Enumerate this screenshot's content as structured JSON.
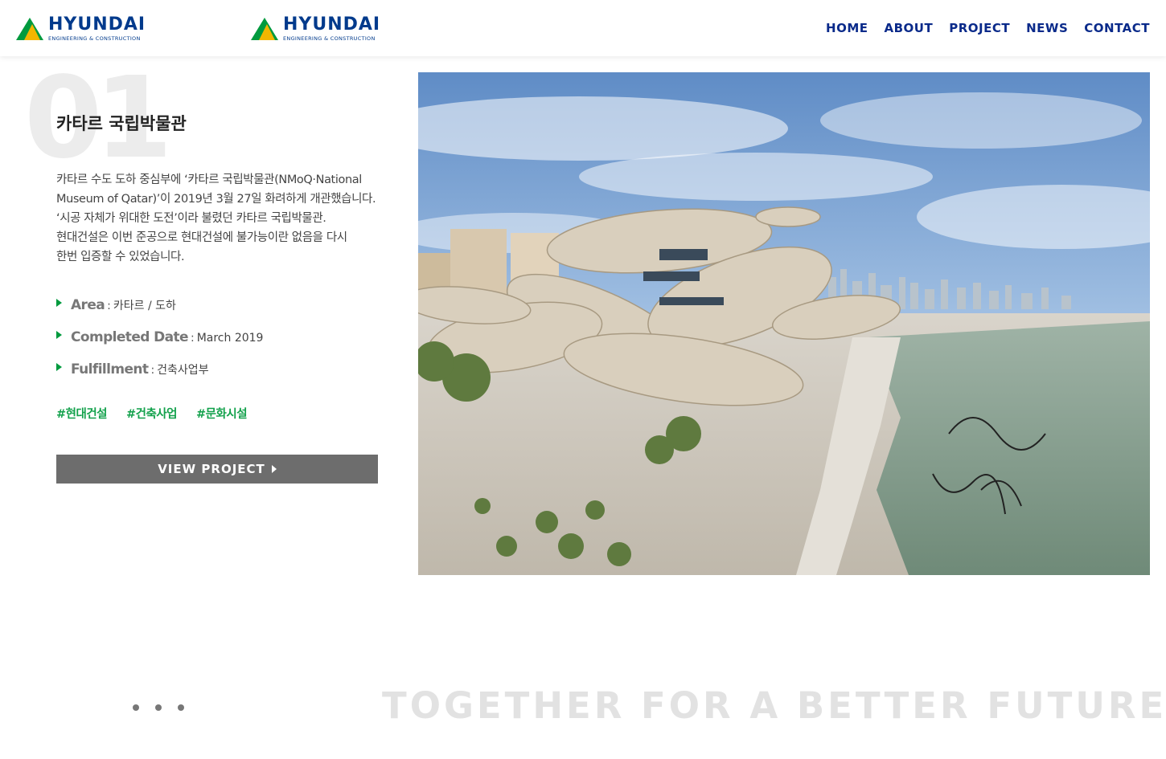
{
  "header": {
    "logo_primary": {
      "name": "HYUNDAI",
      "sub": "ENGINEERING & CONSTRUCTION"
    },
    "logo_secondary": {
      "name": "HYUNDAI",
      "sub": "ENGINEERING & CONSTRUCTION"
    },
    "nav": [
      "HOME",
      "ABOUT",
      "PROJECT",
      "NEWS",
      "CONTACT"
    ]
  },
  "project": {
    "number": "01",
    "title": "카타르 국립박물관",
    "description_lines": [
      "카타르 수도 도하 중심부에 ‘카타르 국립박물관(NMoQ·National",
      "Museum of Qatar)’이 2019년 3월 27일 화려하게 개관했습니다.",
      "‘시공 자체가 위대한 도전’이라 불렸던 카타르 국립박물관.",
      "현대건설은 이번 준공으로 현대건설에 불가능이란 없음을 다시",
      "한번 입증할 수 있었습니다."
    ],
    "info": [
      {
        "label": "Area",
        "value": "카타르 / 도하"
      },
      {
        "label": "Completed Date",
        "value": "March 2019"
      },
      {
        "label": "Fulfillment",
        "value": "건축사업부"
      }
    ],
    "tags": [
      "#현대건설",
      "#건축사업",
      "#문화시설"
    ],
    "button_label": "VIEW PROJECT"
  },
  "slider": {
    "dot_count": 3
  },
  "slogan": "TOGETHER FOR A BETTER FUTURE",
  "colors": {
    "brand_blue": "#0a2a8a",
    "brand_green": "#009a3e",
    "accent_yellow": "#f2b600",
    "tag_green": "#12a14b",
    "button_gray": "#6d6d6d"
  }
}
